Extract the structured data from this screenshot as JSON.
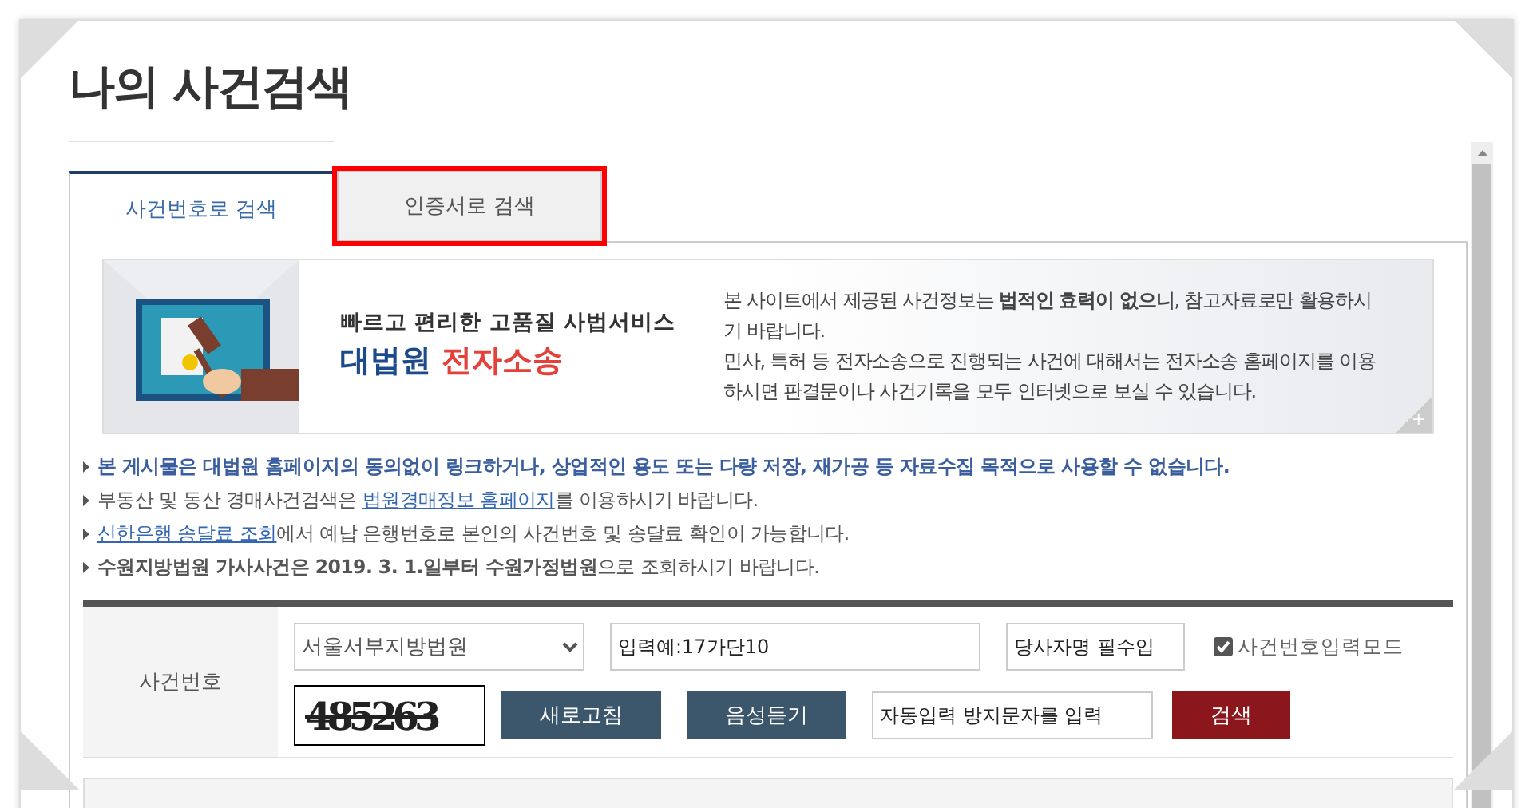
{
  "page_title": "나의 사건검색",
  "tabs": [
    {
      "label": "사건번호로 검색",
      "selected": true,
      "highlighted": false
    },
    {
      "label": "인증서로 검색",
      "selected": false,
      "highlighted": true
    }
  ],
  "banner": {
    "tagline": "빠르고 편리한 고품질 사법서비스",
    "brand_main": "대법원",
    "brand_accent": "전자소송",
    "paragraphs": [
      "본 사이트에서 제공된 사건정보는 **법적인 효력이 없으니**, 참고자료로만 활용하시기 바랍니다.",
      "민사, 특허 등 전자소송으로 진행되는 사건에 대해서는 전자소송 홈페이지를 이용하시면 판결문이나 사건기록을 모두 인터넷으로 보실 수 있습니다."
    ],
    "more": "+"
  },
  "notices": [
    {
      "kind": "bold",
      "parts": [
        {
          "kind": "text",
          "text": "본 게시물은 대법원 홈페이지의 동의없이 링크하거나, 상업적인 용도 또는 다량 저장, 재가공 등 자료수집 목적으로 사용할 수 없습니다."
        }
      ]
    },
    {
      "kind": "plain",
      "parts": [
        {
          "kind": "text",
          "text": "부동산 및 동산 경매사건검색은 "
        },
        {
          "kind": "link",
          "text": "법원경매정보 홈페이지"
        },
        {
          "kind": "text",
          "text": "를 이용하시기 바랍니다."
        }
      ]
    },
    {
      "kind": "plain",
      "parts": [
        {
          "kind": "link",
          "text": "신한은행 송달료 조회"
        },
        {
          "kind": "text",
          "text": "에서 예납 은행번호로 본인의 사건번호 및 송달료 확인이 가능합니다."
        }
      ]
    },
    {
      "kind": "plain",
      "parts": [
        {
          "kind": "text",
          "text": "**수원지방법원 가사사건은 2019. 3. 1.일부터 수원가정법원**으로 조회하시기 바랍니다."
        }
      ]
    }
  ],
  "form": {
    "label": "사건번호",
    "court": "서울서부지방법원",
    "case_number": {
      "placeholder": "입력예:17가단10"
    },
    "party_name": {
      "placeholder": "당사자명 필수입"
    },
    "mode_checkbox": {
      "label": "사건번호입력모드",
      "checked": true
    },
    "captcha": "485263",
    "refresh_button": "새로고침",
    "audio_button": "음성듣기",
    "captcha_field": {
      "placeholder": "자동입력 방지문자를 입력"
    },
    "search_button": "검색"
  }
}
